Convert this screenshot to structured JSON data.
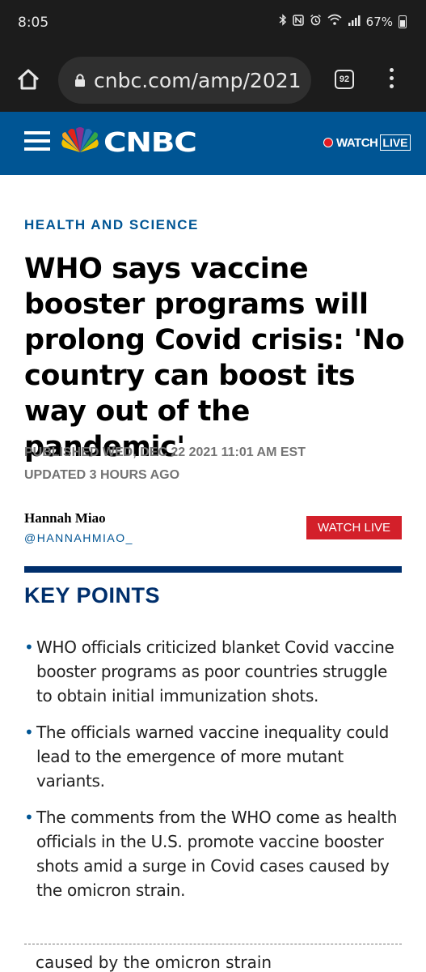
{
  "status_bar": {
    "time": "8:05",
    "battery": "67%",
    "icons": [
      "bluetooth-icon",
      "nfc-icon",
      "alarm-icon",
      "wifi-icon",
      "signal-icon",
      "battery-icon"
    ]
  },
  "browser": {
    "url": "cnbc.com/amp/2021",
    "tab_count": "92",
    "icons": [
      "home-icon",
      "lock-icon",
      "tabs-icon",
      "more-vert-icon"
    ]
  },
  "header": {
    "logo_text": "CNBC",
    "watch_label": "WATCH",
    "live_label": "LIVE",
    "colors": {
      "brand_blue": "#005594",
      "live_red": "#e21a23"
    }
  },
  "article": {
    "section": "HEALTH AND SCIENCE",
    "headline": "WHO says vaccine booster programs will prolong Covid crisis: 'No country can boost its way out of the pandemic'",
    "published": "PUBLISHED WED, DEC 22 2021 11:01 AM EST",
    "updated": "UPDATED 3 HOURS AGO",
    "author": "Hannah Miao",
    "author_handle": "@HANNAHMIAO_",
    "watch_live_button": "WATCH LIVE"
  },
  "key_points": {
    "title": "KEY POINTS",
    "items": [
      "WHO officials criticized blanket Covid vaccine booster programs as poor countries struggle to obtain initial immunization shots.",
      "The officials warned vaccine inequality could lead to the emergence of more mutant variants.",
      "The comments from the WHO come as health officials in the U.S. promote vaccine booster shots amid a surge in Covid cases caused by the omicron strain."
    ],
    "cutoff_text": "caused by the omicron strain"
  }
}
